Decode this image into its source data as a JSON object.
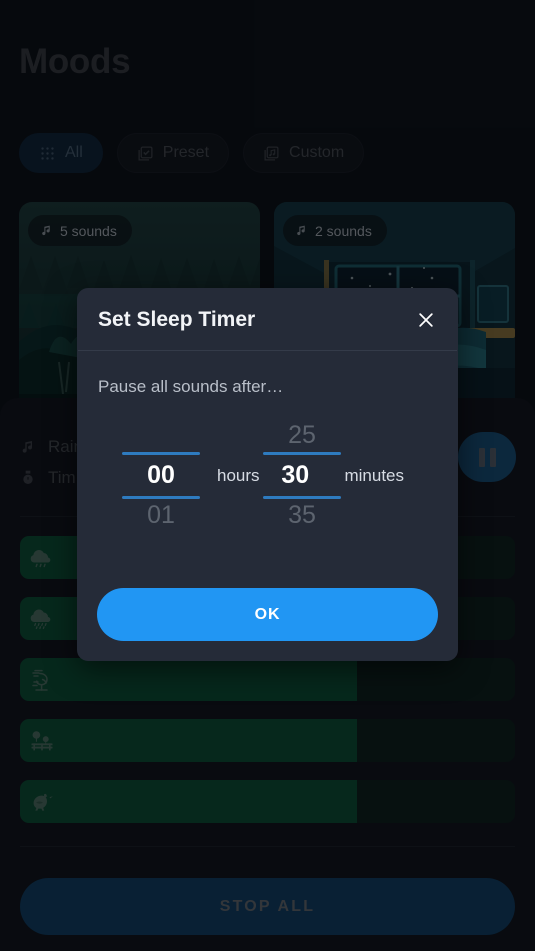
{
  "page": {
    "title": "Moods",
    "filters": [
      {
        "label": "All",
        "icon": "grid-icon",
        "selected": true
      },
      {
        "label": "Preset",
        "icon": "checkbox-icon",
        "selected": false
      },
      {
        "label": "Custom",
        "icon": "music-library-icon",
        "selected": false
      }
    ],
    "cards": [
      {
        "badge": "5 sounds",
        "icon": "music-note-icon",
        "art": "forest"
      },
      {
        "badge": "2 sounds",
        "icon": "music-note-icon",
        "art": "bedroom"
      }
    ]
  },
  "player": {
    "now_playing": "Rain",
    "now_playing_icon": "music-note-icon",
    "timer_label": "Tim",
    "timer_icon": "stopwatch-icon",
    "pause_button": "pause-icon",
    "sounds": [
      {
        "icon": "rain-cloud-icon",
        "volume": 68
      },
      {
        "icon": "heavy-rain-icon",
        "volume": 68
      },
      {
        "icon": "wind-tree-icon",
        "volume": 68
      },
      {
        "icon": "park-bench-icon",
        "volume": 68
      },
      {
        "icon": "bird-icon",
        "volume": 68
      }
    ],
    "stop_all_label": "STOP ALL"
  },
  "dialog": {
    "title": "Set Sleep Timer",
    "close_icon": "close-icon",
    "subtitle": "Pause all sounds after…",
    "hours": {
      "prev": "",
      "value": "00",
      "next": "01",
      "unit": "hours"
    },
    "minutes": {
      "prev": "25",
      "value": "30",
      "next": "35",
      "unit": "minutes"
    },
    "ok_label": "OK"
  },
  "colors": {
    "accent_blue": "#2196f3",
    "underline_blue": "#2e7bbf",
    "dialog_bg": "#252b38",
    "volume_green": "#0a5334",
    "page_bg": "#0b0e13"
  }
}
